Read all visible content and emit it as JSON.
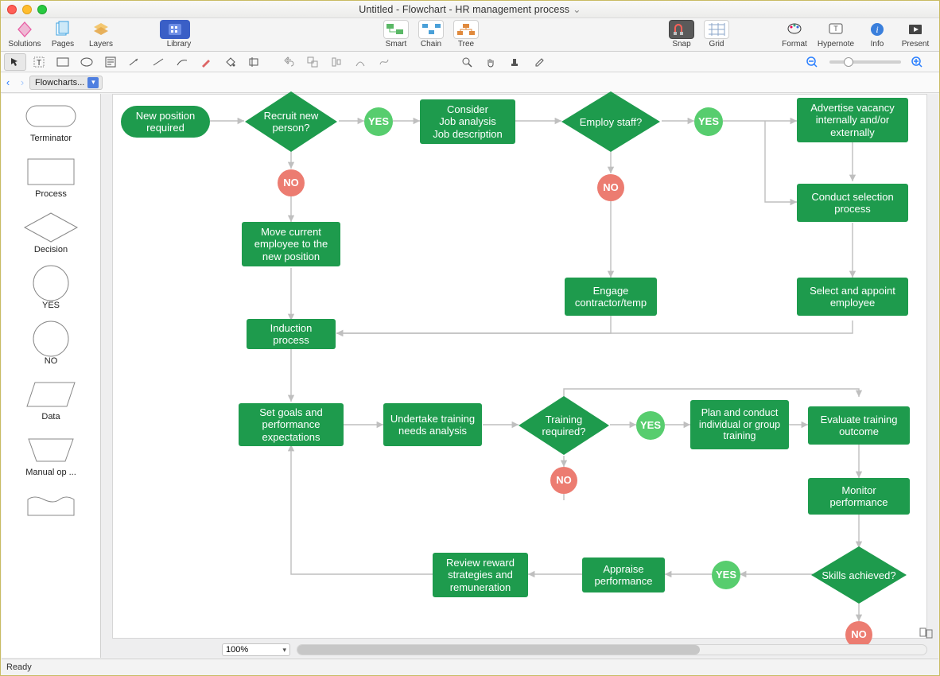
{
  "title": "Untitled - Flowchart - HR management process",
  "toolbar1": {
    "solutions": "Solutions",
    "pages": "Pages",
    "layers": "Layers",
    "library": "Library",
    "smart": "Smart",
    "chain": "Chain",
    "tree": "Tree",
    "snap": "Snap",
    "grid": "Grid",
    "format": "Format",
    "hypernote": "Hypernote",
    "info": "Info",
    "present": "Present"
  },
  "breadcrumb": {
    "label": "Flowcharts..."
  },
  "palette": {
    "terminator": "Terminator",
    "process": "Process",
    "decision": "Decision",
    "yes": "YES",
    "no": "NO",
    "data": "Data",
    "manualop": "Manual op ..."
  },
  "zoom": "100%",
  "status": "Ready",
  "nodes": {
    "new_position": "New position required",
    "recruit_new": "Recruit new person?",
    "yes1": "YES",
    "no1": "NO",
    "consider": "Consider\nJob analysis\nJob description",
    "employ_staff": "Employ staff?",
    "yes2": "YES",
    "no2": "NO",
    "advertise": "Advertise vacancy internally and/or externally",
    "conduct_sel": "Conduct selection process",
    "select_appoint": "Select and appoint employee",
    "engage": "Engage contractor/temp",
    "move_current": "Move current employee to the new position",
    "induction": "Induction process",
    "set_goals": "Set goals and performance expectations",
    "training_needs": "Undertake training needs analysis",
    "training_req": "Training required?",
    "yes3": "YES",
    "no3": "NO",
    "plan_training": "Plan and conduct individual or group training",
    "evaluate": "Evaluate training outcome",
    "monitor": "Monitor performance",
    "skills": "Skills achieved?",
    "yes4": "YES",
    "no4": "NO",
    "appraise": "Appraise performance",
    "review_reward": "Review reward strategies and remuneration"
  }
}
